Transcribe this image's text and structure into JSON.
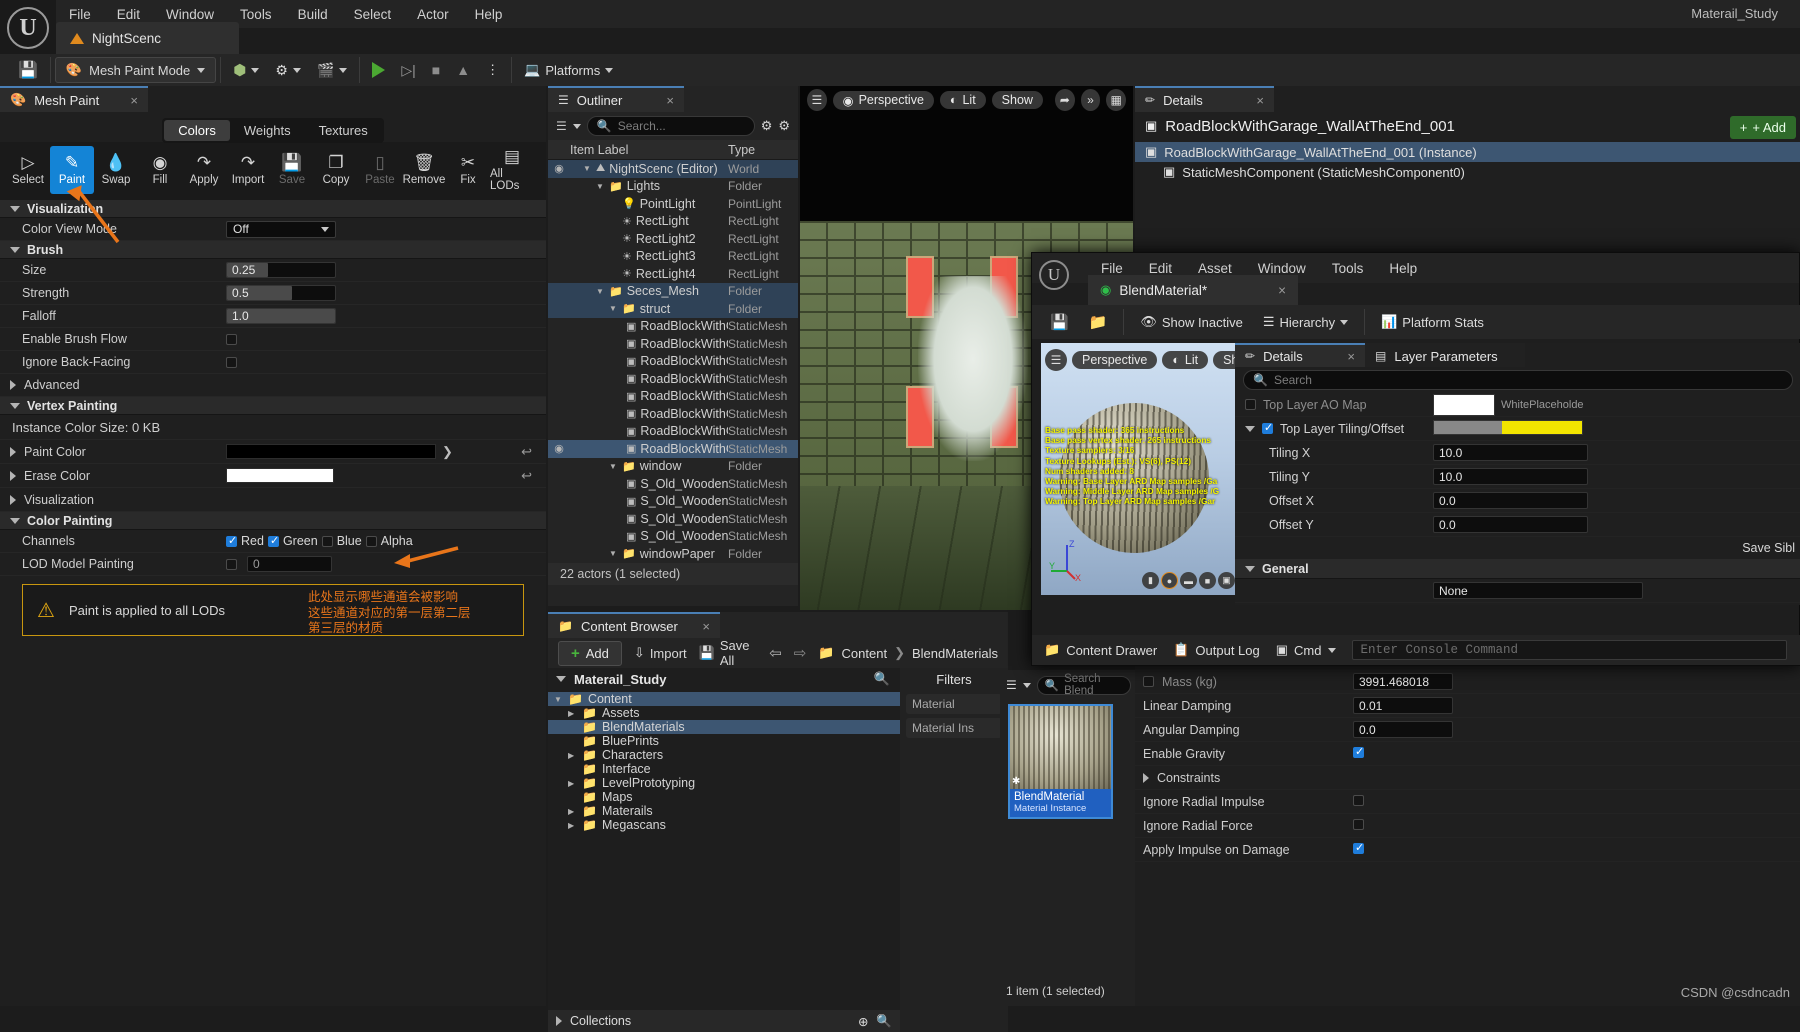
{
  "app": {
    "project_name": "Materail_Study",
    "menu": [
      "File",
      "Edit",
      "Window",
      "Tools",
      "Build",
      "Select",
      "Actor",
      "Help"
    ],
    "level_tab": "NightScenc",
    "watermark": "CSDN @csdncadn"
  },
  "toolbar": {
    "save_icon": "save-icon",
    "mode_label": "Mesh Paint Mode",
    "create_label": "create-icon",
    "blueprints_label": "blueprints-icon",
    "cinematics_label": "cinematics-icon",
    "platforms_label": "Platforms"
  },
  "mesh_paint": {
    "tab_title": "Mesh Paint",
    "mode_tabs": [
      {
        "label": "Colors",
        "active": true
      },
      {
        "label": "Weights",
        "active": false
      },
      {
        "label": "Textures",
        "active": false
      }
    ],
    "tools": [
      {
        "label": "Select",
        "icon": "cursor-icon",
        "state": "normal"
      },
      {
        "label": "Paint",
        "icon": "brush-icon",
        "state": "active"
      },
      {
        "label": "Swap",
        "icon": "swap-drops-icon",
        "state": "normal"
      },
      {
        "label": "Fill",
        "icon": "paint-bucket-icon",
        "state": "normal"
      },
      {
        "label": "Apply",
        "icon": "apply-icon",
        "state": "normal"
      },
      {
        "label": "Import",
        "icon": "import-icon",
        "state": "normal"
      },
      {
        "label": "Save",
        "icon": "save-icon",
        "state": "disabled"
      },
      {
        "label": "Copy",
        "icon": "copy-icon",
        "state": "normal"
      },
      {
        "label": "Paste",
        "icon": "paste-icon",
        "state": "disabled"
      },
      {
        "label": "Remove",
        "icon": "trash-icon",
        "state": "normal"
      },
      {
        "label": "Fix",
        "icon": "wrench-icon",
        "state": "normal"
      },
      {
        "label": "All LODs",
        "icon": "all-lods-icon",
        "state": "normal"
      }
    ],
    "sections": {
      "visualization": "Visualization",
      "brush": "Brush",
      "advanced": "Advanced",
      "vertex_painting": "Vertex Painting",
      "visualization2": "Visualization",
      "color_painting": "Color Painting"
    },
    "color_view_mode": {
      "label": "Color View Mode",
      "value": "Off"
    },
    "brush": [
      {
        "label": "Size",
        "value": "0.25",
        "fill_pct": 38
      },
      {
        "label": "Strength",
        "value": "0.5",
        "fill_pct": 60
      },
      {
        "label": "Falloff",
        "value": "1.0",
        "fill_pct": 100
      }
    ],
    "enable_brush_flow": {
      "label": "Enable Brush Flow",
      "checked": false
    },
    "ignore_back_facing": {
      "label": "Ignore Back-Facing",
      "checked": false
    },
    "instance_color_size": "Instance Color Size: 0 KB",
    "paint_color": {
      "label": "Paint Color",
      "hex": "#000000"
    },
    "erase_color": {
      "label": "Erase Color",
      "hex": "#ffffff"
    },
    "channels": {
      "label": "Channels",
      "items": [
        {
          "label": "Red",
          "checked": true
        },
        {
          "label": "Green",
          "checked": true
        },
        {
          "label": "Blue",
          "checked": false
        },
        {
          "label": "Alpha",
          "checked": false
        }
      ]
    },
    "lod_model_painting": {
      "label": "LOD Model Painting",
      "checked": false,
      "value": "0"
    },
    "warning": {
      "text": "Paint is applied to all LODs",
      "icon": "warning-triangle-icon",
      "color": "#e8751a"
    },
    "annotation_lines": [
      "此处显示哪些通道会被影响",
      "这些通道对应的第一层第二层",
      "第三层的材质"
    ]
  },
  "outliner": {
    "title": "Outliner",
    "search_placeholder": "Search...",
    "columns": {
      "item_label": "Item Label",
      "type": "Type"
    },
    "rows": [
      {
        "label": "NightScenc (Editor)",
        "type": "World",
        "indent": 1,
        "icon": "world-icon",
        "expanded": true,
        "selected": false,
        "highlight": true
      },
      {
        "label": "Lights",
        "type": "Folder",
        "indent": 2,
        "icon": "folder-icon",
        "expanded": true
      },
      {
        "label": "PointLight",
        "type": "PointLight",
        "indent": 3,
        "icon": "pointlight-icon"
      },
      {
        "label": "RectLight",
        "type": "RectLight",
        "indent": 3,
        "icon": "rectlight-icon"
      },
      {
        "label": "RectLight2",
        "type": "RectLight",
        "indent": 3,
        "icon": "rectlight-icon"
      },
      {
        "label": "RectLight3",
        "type": "RectLight",
        "indent": 3,
        "icon": "rectlight-icon"
      },
      {
        "label": "RectLight4",
        "type": "RectLight",
        "indent": 3,
        "icon": "rectlight-icon"
      },
      {
        "label": "Seces_Mesh",
        "type": "Folder",
        "indent": 2,
        "icon": "folder-icon",
        "expanded": true,
        "highlight": true
      },
      {
        "label": "struct",
        "type": "Folder",
        "indent": 3,
        "icon": "folder-icon",
        "expanded": true,
        "highlight": true
      },
      {
        "label": "RoadBlockWithGa",
        "type": "StaticMesh",
        "indent": 4,
        "icon": "staticmesh-icon"
      },
      {
        "label": "RoadBlockWithGa",
        "type": "StaticMesh",
        "indent": 4,
        "icon": "staticmesh-icon"
      },
      {
        "label": "RoadBlockWithGa",
        "type": "StaticMesh",
        "indent": 4,
        "icon": "staticmesh-icon"
      },
      {
        "label": "RoadBlockWithGa",
        "type": "StaticMesh",
        "indent": 4,
        "icon": "staticmesh-icon"
      },
      {
        "label": "RoadBlockWithGa",
        "type": "StaticMesh",
        "indent": 4,
        "icon": "staticmesh-icon"
      },
      {
        "label": "RoadBlockWithGa",
        "type": "StaticMesh",
        "indent": 4,
        "icon": "staticmesh-icon"
      },
      {
        "label": "RoadBlockWithGa",
        "type": "StaticMesh",
        "indent": 4,
        "icon": "staticmesh-icon"
      },
      {
        "label": "RoadBlockWithGa",
        "type": "StaticMesh",
        "indent": 4,
        "icon": "staticmesh-icon",
        "selected": true,
        "eye": true
      },
      {
        "label": "window",
        "type": "Folder",
        "indent": 3,
        "icon": "folder-icon",
        "expanded": true
      },
      {
        "label": "S_Old_Wooden_W",
        "type": "StaticMesh",
        "indent": 4,
        "icon": "staticmesh-icon"
      },
      {
        "label": "S_Old_Wooden_W",
        "type": "StaticMesh",
        "indent": 4,
        "icon": "staticmesh-icon"
      },
      {
        "label": "S_Old_Wooden_W",
        "type": "StaticMesh",
        "indent": 4,
        "icon": "staticmesh-icon"
      },
      {
        "label": "S_Old_Wooden_W",
        "type": "StaticMesh",
        "indent": 4,
        "icon": "staticmesh-icon"
      },
      {
        "label": "windowPaper",
        "type": "Folder",
        "indent": 3,
        "icon": "folder-icon",
        "expanded": true
      }
    ],
    "footer": "22 actors (1 selected)"
  },
  "viewport": {
    "perspective": "Perspective",
    "lit": "Lit",
    "show": "Show",
    "menu_icon": "hamburger-icon",
    "select_icon": "cursor-icon",
    "more_icon": "chevron-double-right-icon",
    "grid_icon": "grid-icon"
  },
  "content_browser": {
    "title": "Content Browser",
    "add": "Add",
    "import": "Import",
    "save_all": "Save All",
    "back_icon": "arrow-left-icon",
    "forward_icon": "arrow-right-icon",
    "path": [
      "Content",
      "BlendMaterials"
    ],
    "tree_root": "Materail_Study",
    "tree": [
      {
        "label": "Content",
        "indent": 0,
        "expanded": true,
        "selected": false,
        "highlight": true
      },
      {
        "label": "Assets",
        "indent": 1,
        "expanded": false
      },
      {
        "label": "BlendMaterials",
        "indent": 1,
        "selected": true
      },
      {
        "label": "BluePrints",
        "indent": 1
      },
      {
        "label": "Characters",
        "indent": 1,
        "expanded": false
      },
      {
        "label": "Interface",
        "indent": 1
      },
      {
        "label": "LevelPrototyping",
        "indent": 1,
        "expanded": false
      },
      {
        "label": "Maps",
        "indent": 1
      },
      {
        "label": "Materails",
        "indent": 1,
        "expanded": false
      },
      {
        "label": "Megascans",
        "indent": 1,
        "expanded": false
      }
    ],
    "collections": "Collections",
    "filters_label": "Filters",
    "filter_search_placeholder": "Search Blend",
    "filter_chips": [
      "Material",
      "Material Ins"
    ],
    "asset": {
      "name": "BlendMaterial",
      "type": "Material Instance"
    },
    "footer": "1 item (1 selected)"
  },
  "details": {
    "title": "Details",
    "object_name": "RoadBlockWithGarage_WallAtTheEnd_001",
    "add_button": "+ Add",
    "components": [
      {
        "label": "RoadBlockWithGarage_WallAtTheEnd_001 (Instance)",
        "selected": true,
        "indent": 0
      },
      {
        "label": "StaticMeshComponent (StaticMeshComponent0)",
        "selected": false,
        "indent": 1
      }
    ],
    "physics_rows": [
      {
        "label": "Mass (kg)",
        "value": "3991.468018",
        "type": "checkbox-text",
        "checked": false,
        "dim": true
      },
      {
        "label": "Linear Damping",
        "value": "0.01",
        "type": "text"
      },
      {
        "label": "Angular Damping",
        "value": "0.0",
        "type": "text"
      },
      {
        "label": "Enable Gravity",
        "value": "",
        "type": "checkbox",
        "checked": true
      },
      {
        "label": "Constraints",
        "value": "",
        "type": "expander"
      },
      {
        "label": "Ignore Radial Impulse",
        "value": "",
        "type": "checkbox",
        "checked": false
      },
      {
        "label": "Ignore Radial Force",
        "value": "",
        "type": "checkbox",
        "checked": false
      },
      {
        "label": "Apply Impulse on Damage",
        "value": "",
        "type": "checkbox",
        "checked": true
      }
    ]
  },
  "material_editor": {
    "menu": [
      "File",
      "Edit",
      "Asset",
      "Window",
      "Tools",
      "Help"
    ],
    "tab_title": "BlendMaterial*",
    "toolbar": {
      "save_icon": "save-icon",
      "browse_icon": "browse-icon",
      "show_inactive": "Show Inactive",
      "hierarchy": "Hierarchy",
      "platform_stats": "Platform Stats"
    },
    "viewport": {
      "perspective": "Perspective",
      "lit": "Lit",
      "show": "Sho"
    },
    "shader_stats": [
      "Base pass shader: 365 instructions",
      "Base pass vertex shader: 265 instructions",
      "Texture samplers: 3/16",
      "Texture Lookups (Est.): VS(6), PS(12)",
      "Num shaders added: 8",
      "Warning: Base Layer ARD Map samples /Ga",
      "Warning: Middle Layer ARD Map samples /G",
      "Warning: Top Layer ARD Map samples /Gar"
    ],
    "details_title": "Details",
    "layer_params_tab": "Layer Parameters",
    "search_placeholder": "Search",
    "rows": [
      {
        "label": "Top Layer AO Map",
        "type": "checkbox-swatch",
        "checked": false,
        "dim": true,
        "swatch": "#ffffff",
        "swatch_label": "WhitePlaceholde"
      },
      {
        "label": "Top Layer Tiling/Offset",
        "type": "group",
        "checked": true,
        "swatch": "checker-yellow"
      },
      {
        "label": "Tiling X",
        "type": "text",
        "value": "10.0"
      },
      {
        "label": "Tiling Y",
        "type": "text",
        "value": "10.0"
      },
      {
        "label": "Offset X",
        "type": "text",
        "value": "0.0"
      },
      {
        "label": "Offset Y",
        "type": "text",
        "value": "0.0"
      }
    ],
    "save_sibling": "Save Sibl",
    "general_section": "General",
    "general_value": "None",
    "status_bar": {
      "content_drawer": "Content Drawer",
      "output_log": "Output Log",
      "cmd": "Cmd",
      "console_placeholder": "Enter Console Command"
    }
  }
}
